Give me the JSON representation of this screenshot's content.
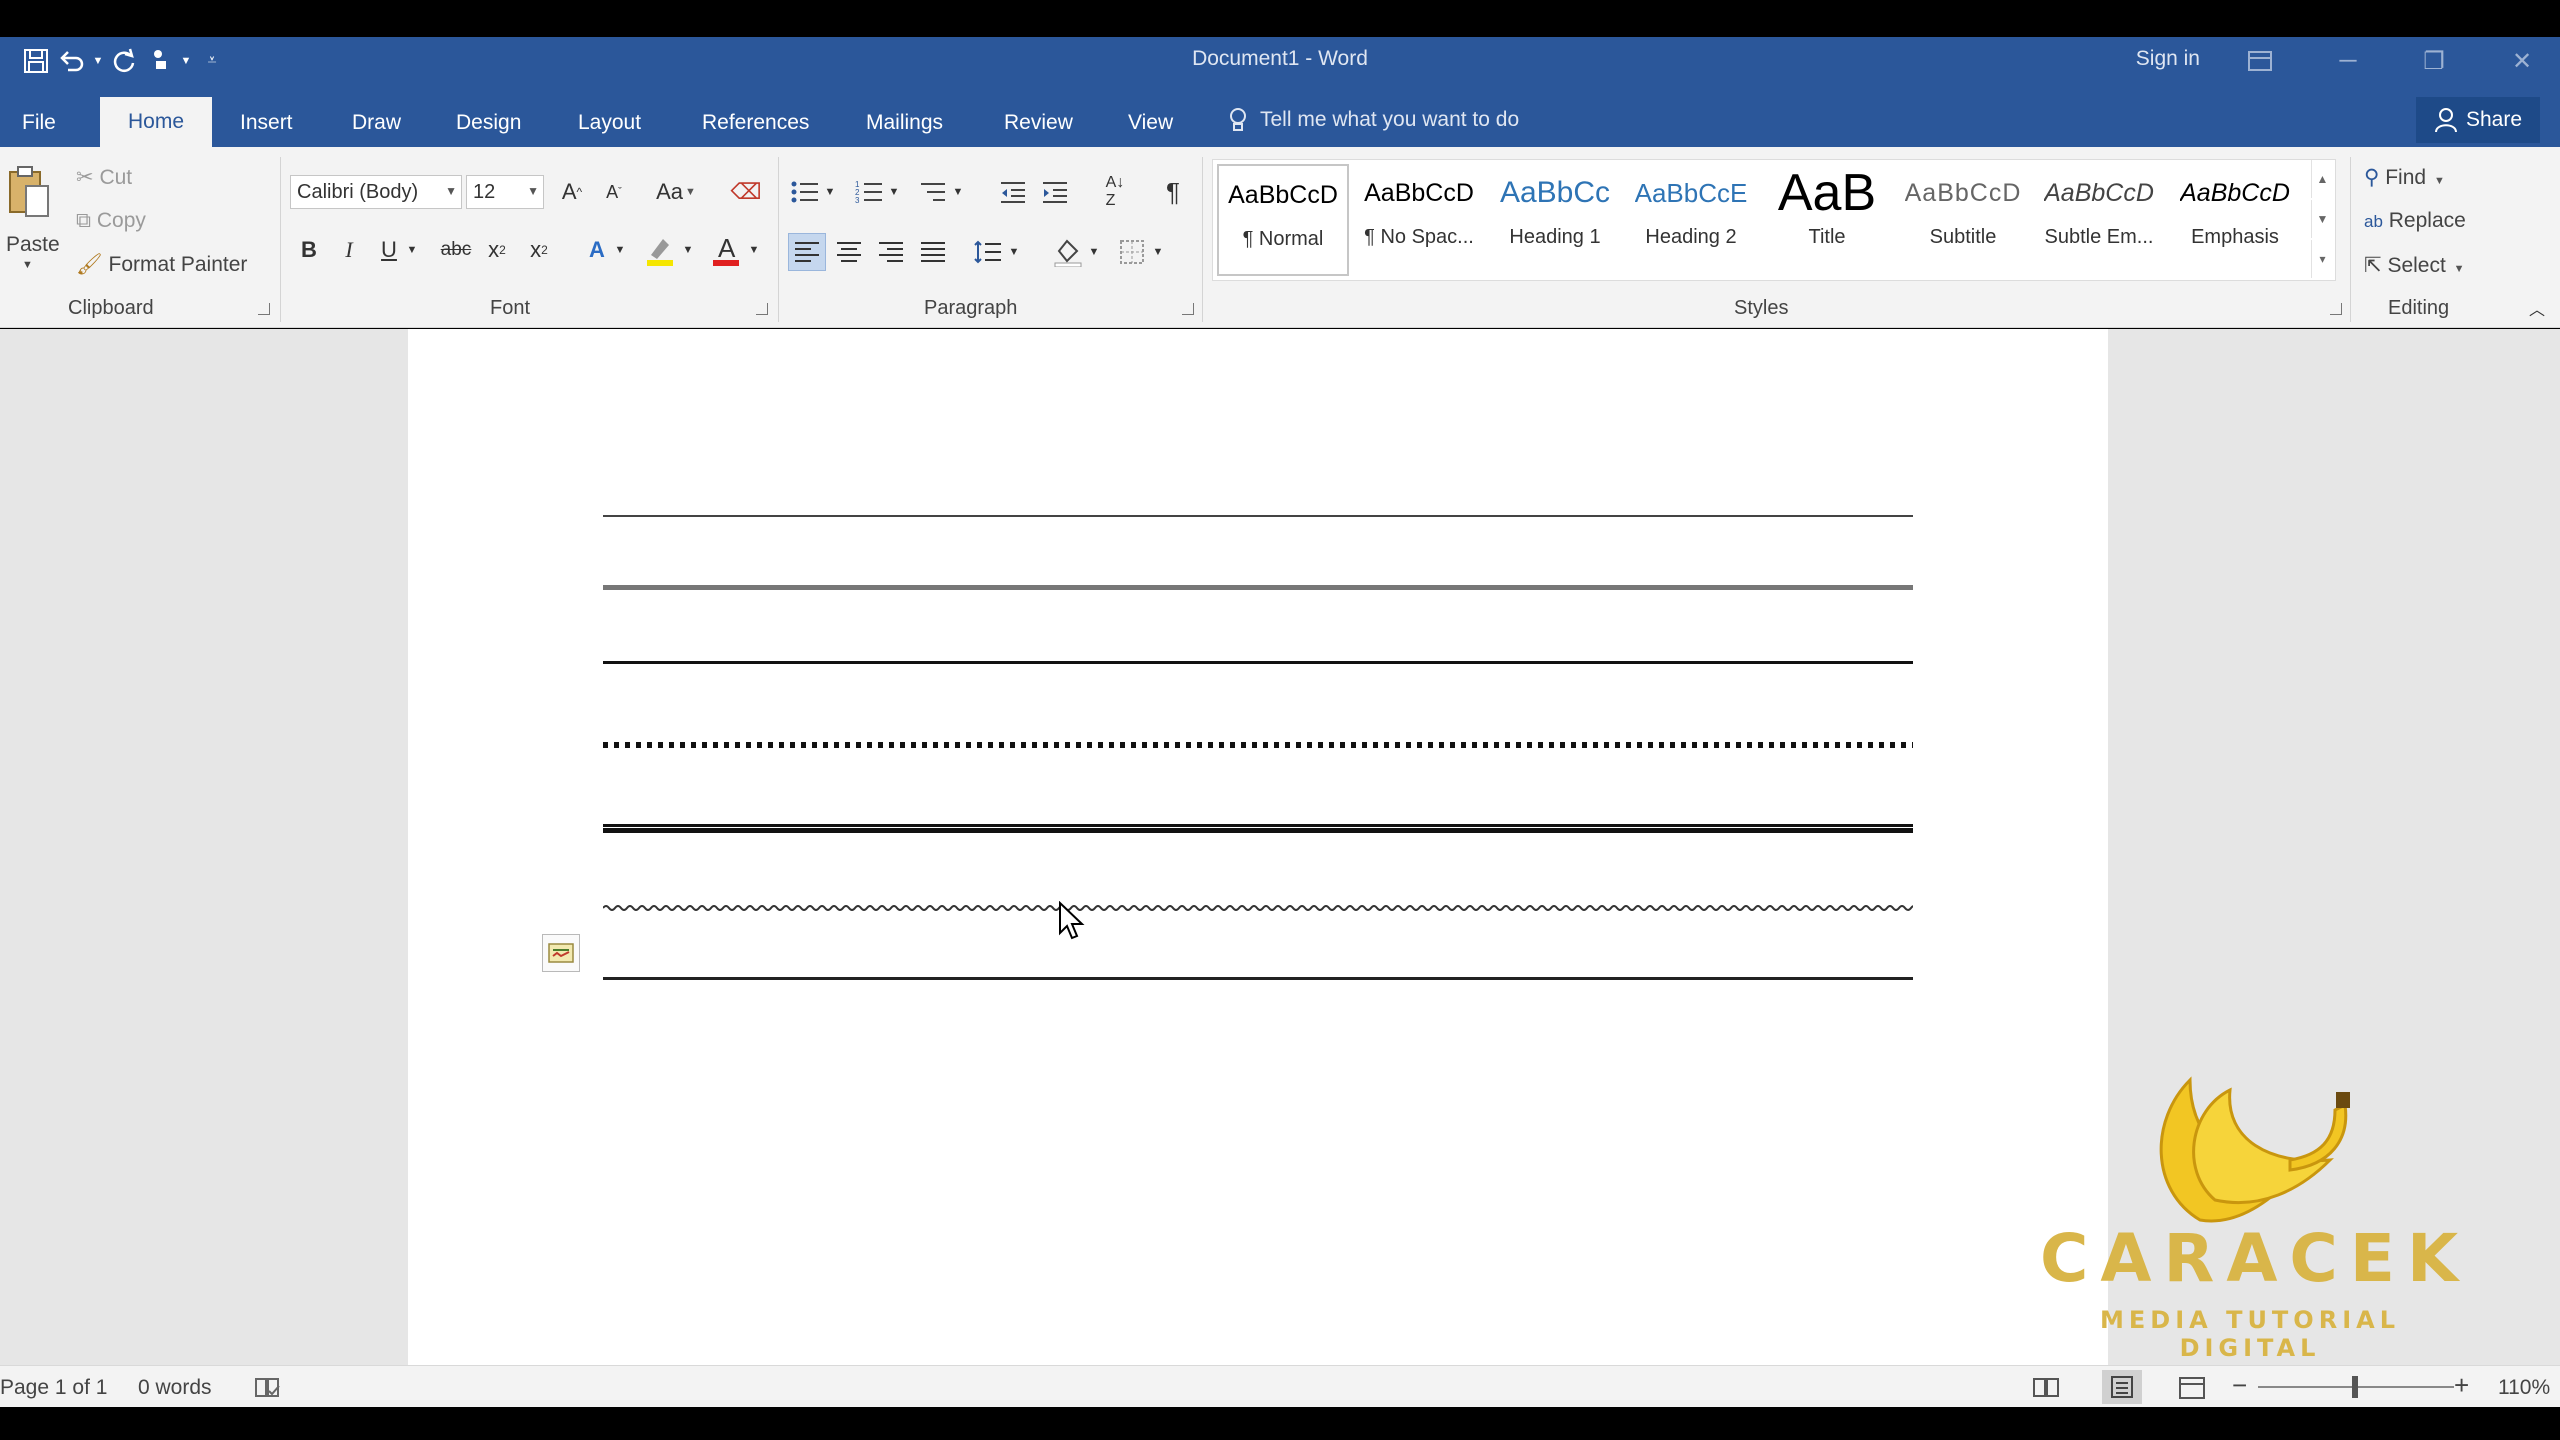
{
  "window": {
    "title": "Document1 - Word",
    "sign_in": "Sign in"
  },
  "tabs": [
    "File",
    "Home",
    "Insert",
    "Draw",
    "Design",
    "Layout",
    "References",
    "Mailings",
    "Review",
    "View"
  ],
  "active_tab": "Home",
  "tell_me": "Tell me what you want to do",
  "share_label": "Share",
  "clipboard": {
    "paste": "Paste",
    "cut": "Cut",
    "copy": "Copy",
    "format_painter": "Format Painter",
    "label": "Clipboard"
  },
  "font": {
    "name": "Calibri (Body)",
    "size": "12",
    "case_label": "Aa",
    "label": "Font"
  },
  "paragraph": {
    "label": "Paragraph"
  },
  "styles": {
    "label": "Styles",
    "items": [
      {
        "preview": "AaBbCcD",
        "name": "¶ Normal"
      },
      {
        "preview": "AaBbCcD",
        "name": "¶ No Spac..."
      },
      {
        "preview": "AaBbCc",
        "name": "Heading 1"
      },
      {
        "preview": "AaBbCcE",
        "name": "Heading 2"
      },
      {
        "preview": "AaB",
        "name": "Title"
      },
      {
        "preview": "AaBbCcD",
        "name": "Subtitle"
      },
      {
        "preview": "AaBbCcD",
        "name": "Subtle Em..."
      },
      {
        "preview": "AaBbCcD",
        "name": "Emphasis"
      }
    ]
  },
  "editing": {
    "find": "Find",
    "replace": "Replace",
    "select": "Select",
    "label": "Editing"
  },
  "status": {
    "page": "Page 1 of 1",
    "words": "0 words",
    "zoom": "110%"
  },
  "watermark": {
    "title": "CARACEK",
    "subtitle": "MEDIA TUTORIAL DIGITAL"
  },
  "colors": {
    "accent": "#2b579a",
    "ribbon_bg": "#f3f3f3",
    "workspace_bg": "#e6e6e6",
    "logo_gold": "#d9b64a"
  }
}
